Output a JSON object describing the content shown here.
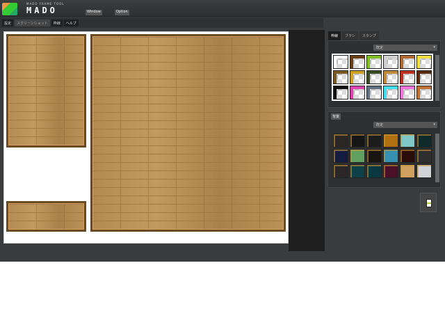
{
  "header": {
    "brand_small": "MADO FRAME TOOL",
    "brand": "MADO",
    "buttons": [
      "Window",
      "Option"
    ]
  },
  "tabs": [
    "設定",
    "スクリーンショット",
    "枠線",
    "ヘルプ"
  ],
  "panel": {
    "tabs": [
      "枠線",
      "ブラシ",
      "スタンプ"
    ],
    "frame_select": "既定",
    "frame_swatches": [
      "#ffffff",
      "#6b3f15",
      "#7fc020",
      "#d0d0d0",
      "#b06a30",
      "#f0e040",
      "#7a5a20",
      "#d0a020",
      "#3a4a20",
      "#c08a3a",
      "#c03020",
      "#5a2a10",
      "#111111",
      "#e040b0",
      "#607080",
      "#40e0f0",
      "#f070e0",
      "#c07030"
    ],
    "section_label": "背景",
    "bg_select": "既定",
    "bg_swatches": [
      "#2a2624",
      "#161616",
      "#1c1c1c",
      "#b07010",
      "#80c8c8",
      "#0e2a2a",
      "#141c40",
      "#60a060",
      "#1a1410",
      "#3890b0",
      "#2a0c08",
      "#2e2e2e",
      "#2a2628",
      "#0e4048",
      "#0a3840",
      "#4a1028",
      "#d0a060",
      "#d0d4d8"
    ]
  }
}
